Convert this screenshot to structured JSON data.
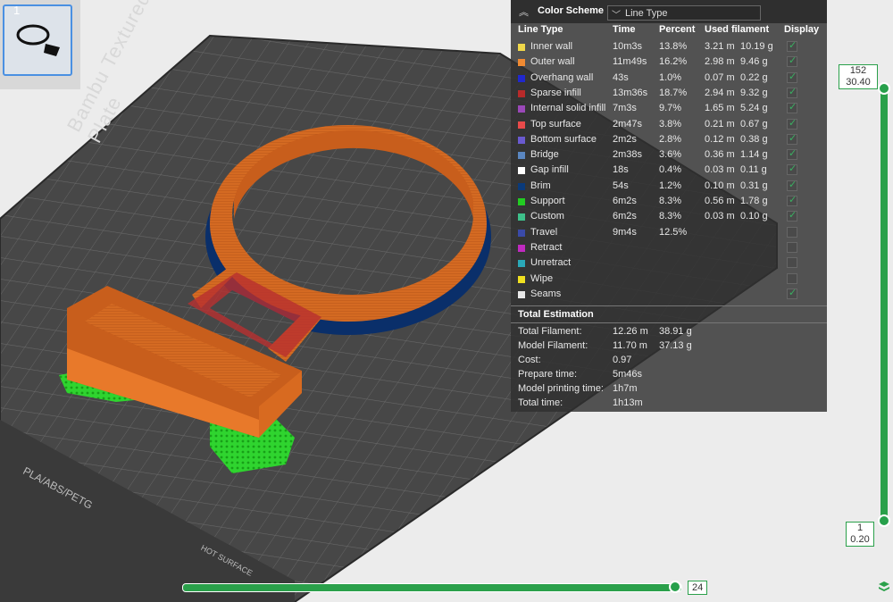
{
  "plate": {
    "title": "Bambu Textured PEI Plate",
    "bottom_label": "PLA/ABS/PETG",
    "hot_label": "HOT SURFACE"
  },
  "thumbnail": {
    "index": "1",
    "icon": "object-thumbnail-icon"
  },
  "color_scheme": {
    "title": "Color Scheme",
    "selected": "Line Type",
    "headers": {
      "line_type": "Line Type",
      "time": "Time",
      "percent": "Percent",
      "used_filament": "Used filament",
      "display": "Display"
    },
    "rows": [
      {
        "name": "Inner wall",
        "color": "#f0d84a",
        "time": "10m3s",
        "percent": "13.8%",
        "length": "3.21 m",
        "weight": "10.19 g",
        "display": true
      },
      {
        "name": "Outer wall",
        "color": "#f08a32",
        "time": "11m49s",
        "percent": "16.2%",
        "length": "2.98 m",
        "weight": "9.46 g",
        "display": true
      },
      {
        "name": "Overhang wall",
        "color": "#2028ce",
        "time": "43s",
        "percent": "1.0%",
        "length": "0.07 m",
        "weight": "0.22 g",
        "display": true
      },
      {
        "name": "Sparse infill",
        "color": "#b82a2a",
        "time": "13m36s",
        "percent": "18.7%",
        "length": "2.94 m",
        "weight": "9.32 g",
        "display": true
      },
      {
        "name": "Internal solid infill",
        "color": "#9a48b8",
        "time": "7m3s",
        "percent": "9.7%",
        "length": "1.65 m",
        "weight": "5.24 g",
        "display": true
      },
      {
        "name": "Top surface",
        "color": "#e84a4a",
        "time": "2m47s",
        "percent": "3.8%",
        "length": "0.21 m",
        "weight": "0.67 g",
        "display": true
      },
      {
        "name": "Bottom surface",
        "color": "#6a5ad0",
        "time": "2m2s",
        "percent": "2.8%",
        "length": "0.12 m",
        "weight": "0.38 g",
        "display": true
      },
      {
        "name": "Bridge",
        "color": "#5a86c0",
        "time": "2m38s",
        "percent": "3.6%",
        "length": "0.36 m",
        "weight": "1.14 g",
        "display": true
      },
      {
        "name": "Gap infill",
        "color": "#ffffff",
        "time": "18s",
        "percent": "0.4%",
        "length": "0.03 m",
        "weight": "0.11 g",
        "display": true
      },
      {
        "name": "Brim",
        "color": "#0a3a7a",
        "time": "54s",
        "percent": "1.2%",
        "length": "0.10 m",
        "weight": "0.31 g",
        "display": true
      },
      {
        "name": "Support",
        "color": "#22cc22",
        "time": "6m2s",
        "percent": "8.3%",
        "length": "0.56 m",
        "weight": "1.78 g",
        "display": true
      },
      {
        "name": "Custom",
        "color": "#3ec08a",
        "time": "6m2s",
        "percent": "8.3%",
        "length": "0.03 m",
        "weight": "0.10 g",
        "display": true
      },
      {
        "name": "Travel",
        "color": "#3a4aa8",
        "time": "9m4s",
        "percent": "12.5%",
        "length": "",
        "weight": "",
        "display": false
      },
      {
        "name": "Retract",
        "color": "#c02ac0",
        "time": "",
        "percent": "",
        "length": "",
        "weight": "",
        "display": false
      },
      {
        "name": "Unretract",
        "color": "#2aa8b8",
        "time": "",
        "percent": "",
        "length": "",
        "weight": "",
        "display": false
      },
      {
        "name": "Wipe",
        "color": "#f0e020",
        "time": "",
        "percent": "",
        "length": "",
        "weight": "",
        "display": false
      },
      {
        "name": "Seams",
        "color": "#e8e8e8",
        "time": "",
        "percent": "",
        "length": "",
        "weight": "",
        "display": true
      }
    ]
  },
  "total_estimation": {
    "title": "Total Estimation",
    "items": [
      {
        "label": "Total Filament:",
        "value": "12.26 m",
        "value2": "38.91 g"
      },
      {
        "label": "Model Filament:",
        "value": "11.70 m",
        "value2": "37.13 g"
      },
      {
        "label": "Cost:",
        "value": "0.97",
        "value2": ""
      },
      {
        "label": "Prepare time:",
        "value": "5m46s",
        "value2": ""
      },
      {
        "label": "Model printing time:",
        "value": "1h7m",
        "value2": ""
      },
      {
        "label": "Total time:",
        "value": "1h13m",
        "value2": ""
      }
    ]
  },
  "layer_slider": {
    "top_layer": "152",
    "top_height": "30.40",
    "bottom_layer": "1",
    "bottom_height": "0.20"
  },
  "move_slider": {
    "value": "24"
  },
  "colors": {
    "accent": "#2aa04a",
    "model": "#d86a20",
    "support": "#33dd33"
  }
}
